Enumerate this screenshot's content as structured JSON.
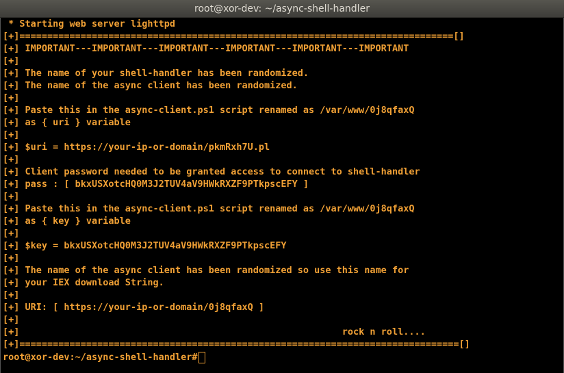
{
  "window": {
    "title": "root@xor-dev: ~/async-shell-handler"
  },
  "terminal": {
    "lines": [
      " * Starting web server lighttpd",
      "[+]==============================================================================[]",
      "[+] IMPORTANT---IMPORTANT---IMPORTANT---IMPORTANT---IMPORTANT---IMPORTANT",
      "[+]",
      "[+] The name of your shell-handler has been randomized.",
      "[+] The name of the async client has been randomized.",
      "[+]",
      "[+] Paste this in the async-client.ps1 script renamed as /var/www/0j8qfaxQ",
      "[+] as { uri } variable",
      "[+]",
      "[+] $uri = https://your-ip-or-domain/pkmRxh7U.pl",
      "[+]",
      "[+] Client password needed to be granted access to connect to shell-handler",
      "[+] pass : [ bkxUSXotcHQ0M3J2TUV4aV9HWkRXZF9PTkpscEFY ]",
      "[+]",
      "[+] Paste this in the async-client.ps1 script renamed as /var/www/0j8qfaxQ",
      "[+] as { key } variable",
      "[+]",
      "[+] $key = bkxUSXotcHQ0M3J2TUV4aV9HWkRXZF9PTkpscEFY",
      "[+]",
      "[+] The name of the async client has been randomized so use this name for",
      "[+] your IEX download String.",
      "[+]",
      "[+] URI: [ https://your-ip-or-domain/0j8qfaxQ ]",
      "[+]",
      "[+]                                                          rock n roll....",
      "[+]===============================================================================[]"
    ],
    "prompt": "root@xor-dev:~/async-shell-handler#"
  },
  "colors": {
    "text": "#f0a035",
    "background": "#000000",
    "titlebar": "#4a4944"
  }
}
